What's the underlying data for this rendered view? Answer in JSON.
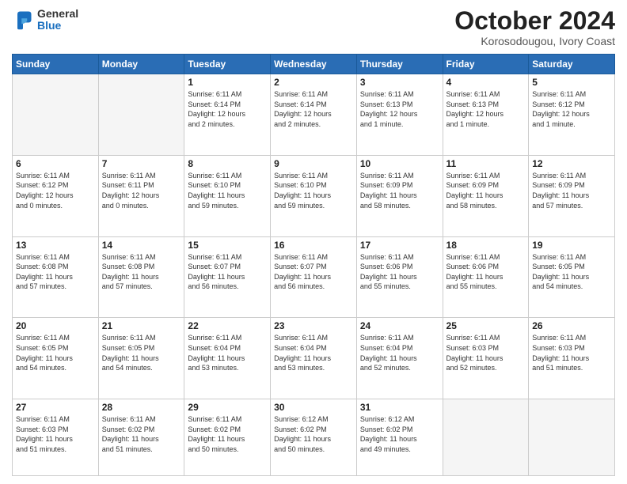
{
  "header": {
    "logo_general": "General",
    "logo_blue": "Blue",
    "month_title": "October 2024",
    "location": "Korosodougou, Ivory Coast"
  },
  "days_of_week": [
    "Sunday",
    "Monday",
    "Tuesday",
    "Wednesday",
    "Thursday",
    "Friday",
    "Saturday"
  ],
  "weeks": [
    [
      {
        "day": "",
        "info": ""
      },
      {
        "day": "",
        "info": ""
      },
      {
        "day": "1",
        "info": "Sunrise: 6:11 AM\nSunset: 6:14 PM\nDaylight: 12 hours\nand 2 minutes."
      },
      {
        "day": "2",
        "info": "Sunrise: 6:11 AM\nSunset: 6:14 PM\nDaylight: 12 hours\nand 2 minutes."
      },
      {
        "day": "3",
        "info": "Sunrise: 6:11 AM\nSunset: 6:13 PM\nDaylight: 12 hours\nand 1 minute."
      },
      {
        "day": "4",
        "info": "Sunrise: 6:11 AM\nSunset: 6:13 PM\nDaylight: 12 hours\nand 1 minute."
      },
      {
        "day": "5",
        "info": "Sunrise: 6:11 AM\nSunset: 6:12 PM\nDaylight: 12 hours\nand 1 minute."
      }
    ],
    [
      {
        "day": "6",
        "info": "Sunrise: 6:11 AM\nSunset: 6:12 PM\nDaylight: 12 hours\nand 0 minutes."
      },
      {
        "day": "7",
        "info": "Sunrise: 6:11 AM\nSunset: 6:11 PM\nDaylight: 12 hours\nand 0 minutes."
      },
      {
        "day": "8",
        "info": "Sunrise: 6:11 AM\nSunset: 6:10 PM\nDaylight: 11 hours\nand 59 minutes."
      },
      {
        "day": "9",
        "info": "Sunrise: 6:11 AM\nSunset: 6:10 PM\nDaylight: 11 hours\nand 59 minutes."
      },
      {
        "day": "10",
        "info": "Sunrise: 6:11 AM\nSunset: 6:09 PM\nDaylight: 11 hours\nand 58 minutes."
      },
      {
        "day": "11",
        "info": "Sunrise: 6:11 AM\nSunset: 6:09 PM\nDaylight: 11 hours\nand 58 minutes."
      },
      {
        "day": "12",
        "info": "Sunrise: 6:11 AM\nSunset: 6:09 PM\nDaylight: 11 hours\nand 57 minutes."
      }
    ],
    [
      {
        "day": "13",
        "info": "Sunrise: 6:11 AM\nSunset: 6:08 PM\nDaylight: 11 hours\nand 57 minutes."
      },
      {
        "day": "14",
        "info": "Sunrise: 6:11 AM\nSunset: 6:08 PM\nDaylight: 11 hours\nand 57 minutes."
      },
      {
        "day": "15",
        "info": "Sunrise: 6:11 AM\nSunset: 6:07 PM\nDaylight: 11 hours\nand 56 minutes."
      },
      {
        "day": "16",
        "info": "Sunrise: 6:11 AM\nSunset: 6:07 PM\nDaylight: 11 hours\nand 56 minutes."
      },
      {
        "day": "17",
        "info": "Sunrise: 6:11 AM\nSunset: 6:06 PM\nDaylight: 11 hours\nand 55 minutes."
      },
      {
        "day": "18",
        "info": "Sunrise: 6:11 AM\nSunset: 6:06 PM\nDaylight: 11 hours\nand 55 minutes."
      },
      {
        "day": "19",
        "info": "Sunrise: 6:11 AM\nSunset: 6:05 PM\nDaylight: 11 hours\nand 54 minutes."
      }
    ],
    [
      {
        "day": "20",
        "info": "Sunrise: 6:11 AM\nSunset: 6:05 PM\nDaylight: 11 hours\nand 54 minutes."
      },
      {
        "day": "21",
        "info": "Sunrise: 6:11 AM\nSunset: 6:05 PM\nDaylight: 11 hours\nand 54 minutes."
      },
      {
        "day": "22",
        "info": "Sunrise: 6:11 AM\nSunset: 6:04 PM\nDaylight: 11 hours\nand 53 minutes."
      },
      {
        "day": "23",
        "info": "Sunrise: 6:11 AM\nSunset: 6:04 PM\nDaylight: 11 hours\nand 53 minutes."
      },
      {
        "day": "24",
        "info": "Sunrise: 6:11 AM\nSunset: 6:04 PM\nDaylight: 11 hours\nand 52 minutes."
      },
      {
        "day": "25",
        "info": "Sunrise: 6:11 AM\nSunset: 6:03 PM\nDaylight: 11 hours\nand 52 minutes."
      },
      {
        "day": "26",
        "info": "Sunrise: 6:11 AM\nSunset: 6:03 PM\nDaylight: 11 hours\nand 51 minutes."
      }
    ],
    [
      {
        "day": "27",
        "info": "Sunrise: 6:11 AM\nSunset: 6:03 PM\nDaylight: 11 hours\nand 51 minutes."
      },
      {
        "day": "28",
        "info": "Sunrise: 6:11 AM\nSunset: 6:02 PM\nDaylight: 11 hours\nand 51 minutes."
      },
      {
        "day": "29",
        "info": "Sunrise: 6:11 AM\nSunset: 6:02 PM\nDaylight: 11 hours\nand 50 minutes."
      },
      {
        "day": "30",
        "info": "Sunrise: 6:12 AM\nSunset: 6:02 PM\nDaylight: 11 hours\nand 50 minutes."
      },
      {
        "day": "31",
        "info": "Sunrise: 6:12 AM\nSunset: 6:02 PM\nDaylight: 11 hours\nand 49 minutes."
      },
      {
        "day": "",
        "info": ""
      },
      {
        "day": "",
        "info": ""
      }
    ]
  ]
}
